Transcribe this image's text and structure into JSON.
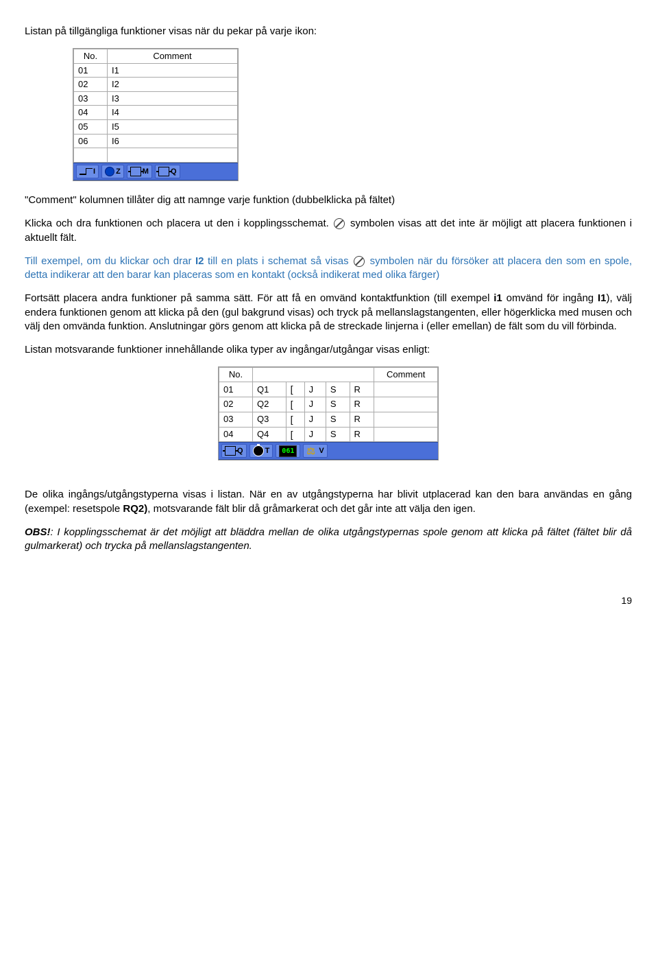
{
  "intro": "Listan på tillgängliga funktioner visas när du pekar på varje ikon:",
  "table1": {
    "headers": [
      "No.",
      "Comment"
    ],
    "rows": [
      [
        "01",
        "I1"
      ],
      [
        "02",
        "I2"
      ],
      [
        "03",
        "I3"
      ],
      [
        "04",
        "I4"
      ],
      [
        "05",
        "I5"
      ],
      [
        "06",
        "I6"
      ]
    ],
    "toolbar": [
      {
        "type": "line",
        "letter": "I"
      },
      {
        "type": "circle",
        "letter": "Z"
      },
      {
        "type": "coil",
        "letter": "M"
      },
      {
        "type": "coil",
        "letter": "Q"
      }
    ]
  },
  "para1a": "\"Comment\" kolumnen tillåter dig att namnge varje funktion (dubbelklicka på fältet)",
  "para1b_pre": "Klicka och dra funktionen och placera ut den i kopplingsschemat. ",
  "para1b_post": " symbolen visas att det inte är möjligt att placera funktionen i aktuellt fält.",
  "para2_pre": "Till exempel, om du klickar och drar ",
  "para2_bold": "I2",
  "para2_mid": " till en plats i schemat så visas ",
  "para2_post": " symbolen när du försöker att placera den som en spole, detta indikerar att den barar kan placeras som en kontakt (också indikerat med olika färger)",
  "para3_pre": "Fortsätt placera andra funktioner på samma sätt. För att få en omvänd kontaktfunktion (till exempel ",
  "para3_b1": "i1",
  "para3_m1": " omvänd för ingång ",
  "para3_b2": "I1",
  "para3_post": "), välj endera funktionen genom att klicka på den (gul bakgrund visas) och tryck på mellanslagstangenten, eller högerklicka med musen och välj den omvända funktion. Anslutningar görs genom att klicka på de streckade linjerna i (eller emellan) de fält som du vill förbinda.",
  "para4": "Listan motsvarande funktioner innehållande olika typer av ingångar/utgångar visas enligt:",
  "table2": {
    "headers": [
      "No.",
      "",
      "Comment"
    ],
    "rows": [
      [
        "01",
        "Q1",
        [
          "[",
          "J",
          "S",
          "R"
        ]
      ],
      [
        "02",
        "Q2",
        [
          "[",
          "J",
          "S",
          "R"
        ]
      ],
      [
        "03",
        "Q3",
        [
          "[",
          "J",
          "S",
          "R"
        ]
      ],
      [
        "04",
        "Q4",
        [
          "[",
          "J",
          "S",
          "R"
        ]
      ]
    ],
    "toolbar": [
      {
        "type": "coil",
        "letter": "Q"
      },
      {
        "type": "timer",
        "letter": "T"
      },
      {
        "type": "counter",
        "value": "061"
      },
      {
        "type": "scale",
        "letter": "V"
      }
    ]
  },
  "para5_pre": "De olika ingångs/utgångstyperna visas i listan. När en av utgångstyperna har blivit utplacerad kan den bara användas en gång (exempel: resetspole ",
  "para5_bold": "RQ2)",
  "para5_post": ", motsvarande fält blir då gråmarkerat och det går inte att välja den igen.",
  "para6_bold": "OBS!",
  "para6_text": ": I kopplingsschemat är det möjligt att bläddra mellan de olika utgångstypernas spole genom att klicka på fältet (fältet blir då gulmarkerat) och trycka på mellanslagstangenten.",
  "page_number": "19"
}
